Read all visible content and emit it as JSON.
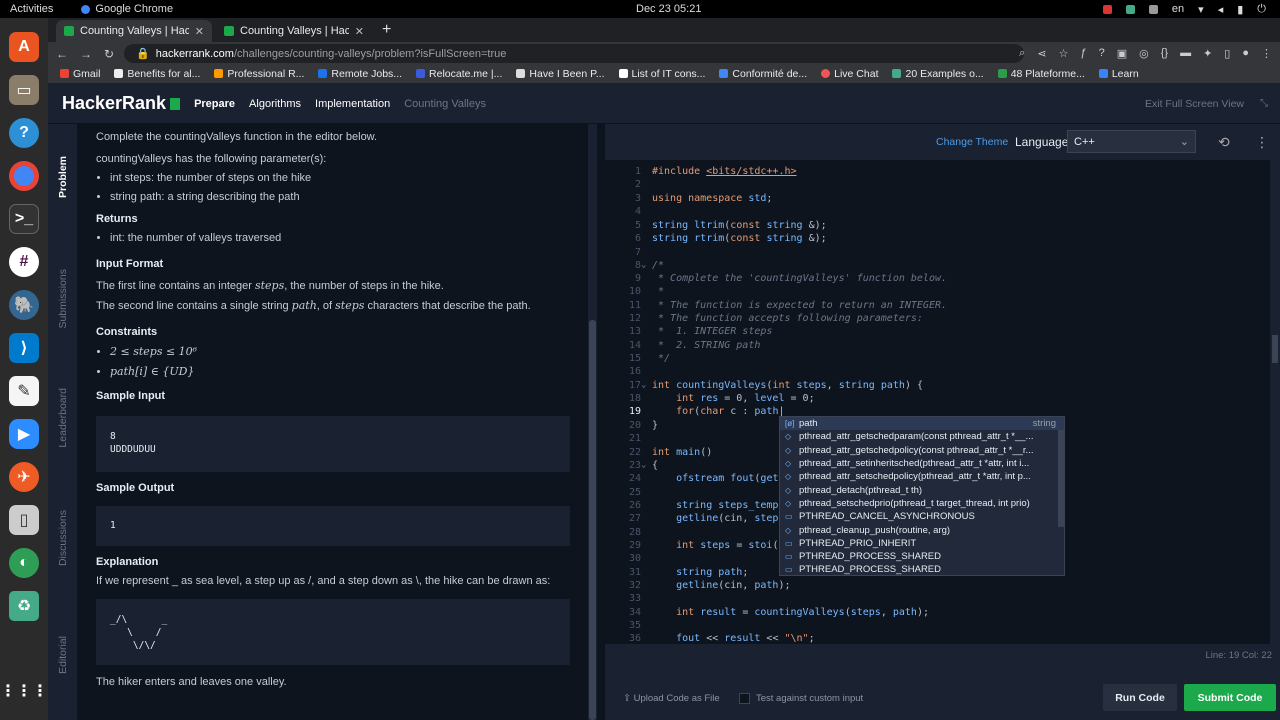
{
  "os": {
    "activities": "Activities",
    "app_name": "Google Chrome",
    "clock": "Dec 23  05:21",
    "lang": "en"
  },
  "browser": {
    "tabs": [
      {
        "title": "Counting Valleys | Hacker"
      },
      {
        "title": "Counting Valleys | Hacker"
      }
    ],
    "url_host": "hackerrank.com",
    "url_path": "/challenges/counting-valleys/problem?isFullScreen=true",
    "bookmarks": [
      "Gmail",
      "Benefits for al...",
      "Professional R...",
      "Remote Jobs...",
      "Relocate.me |...",
      "Have I Been P...",
      "List of IT cons...",
      "Conformité de...",
      "Live Chat",
      "20 Examples o...",
      "48 Plateforme...",
      "Learn"
    ]
  },
  "nav": {
    "logo": "HackerRank",
    "crumbs": [
      "Prepare",
      "Algorithms",
      "Implementation",
      "Counting Valleys"
    ],
    "exit_fullscreen": "Exit Full Screen View"
  },
  "side_tabs": [
    "Problem",
    "Submissions",
    "Leaderboard",
    "Discussions",
    "Editorial"
  ],
  "problem": {
    "intro": "Complete the countingValleys function in the editor below.",
    "params_intro": "countingValleys has the following parameter(s):",
    "params": [
      "int steps: the number of steps on the hike",
      "string path: a string describing the path"
    ],
    "returns_h": "Returns",
    "returns": "int: the number of valleys traversed",
    "input_h": "Input Format",
    "input_1a": "The first line contains an integer ",
    "input_1v": "steps",
    "input_1b": ", the number of steps in the hike.",
    "input_2a": "The second line contains a single string ",
    "input_2v": "path",
    "input_2b": ", of ",
    "input_2v2": "steps",
    "input_2c": " characters that describe the path.",
    "constraints_h": "Constraints",
    "constraint_1": "2 ≤ steps ≤ 10⁶",
    "constraint_2": "path[i] ∈ {UD}",
    "sample_input_h": "Sample Input",
    "sample_input": "8\nUDDDUDUU",
    "sample_output_h": "Sample Output",
    "sample_output": "1",
    "explanation_h": "Explanation",
    "explanation": "If we represent _ as sea level, a step up as /, and a step down as \\, the hike can be drawn as:",
    "drawing": "_/\\      _\n   \\    /\n    \\/\\/",
    "conclusion": "The hiker enters and leaves one valley."
  },
  "editor": {
    "change_theme": "Change Theme",
    "language_label": "Language",
    "language": "C++",
    "status": "Line: 19  Col: 22",
    "upload": "Upload Code as File",
    "custom_input": "Test against custom input",
    "run": "Run Code",
    "submit": "Submit Code",
    "line_numbers": [
      "1",
      "2",
      "3",
      "4",
      "5",
      "6",
      "7",
      "8",
      "9",
      "10",
      "11",
      "12",
      "13",
      "14",
      "15",
      "16",
      "17",
      "18",
      "19",
      "20",
      "21",
      "22",
      "23",
      "24",
      "25",
      "26",
      "27",
      "28",
      "29",
      "30",
      "31",
      "32",
      "33",
      "34",
      "35",
      "36"
    ],
    "autocomplete": [
      {
        "label": "path",
        "type": "string"
      },
      {
        "label": "pthread_attr_getschedparam(const pthread_attr_t *__...",
        "type": ""
      },
      {
        "label": "pthread_attr_getschedpolicy(const pthread_attr_t *__r...",
        "type": ""
      },
      {
        "label": "pthread_attr_setinheritsched(pthread_attr_t *attr, int i...",
        "type": ""
      },
      {
        "label": "pthread_attr_setschedpolicy(pthread_attr_t *attr, int p...",
        "type": ""
      },
      {
        "label": "pthread_detach(pthread_t th)",
        "type": ""
      },
      {
        "label": "pthread_setschedprio(pthread_t target_thread, int prio)",
        "type": ""
      },
      {
        "label": "PTHREAD_CANCEL_ASYNCHRONOUS",
        "type": ""
      },
      {
        "label": "pthread_cleanup_push(routine, arg)",
        "type": ""
      },
      {
        "label": "PTHREAD_PRIO_INHERIT",
        "type": ""
      },
      {
        "label": "PTHREAD_PROCESS_SHARED",
        "type": ""
      },
      {
        "label": "PTHREAD_PROCESS_SHARED",
        "type": ""
      }
    ]
  },
  "colors": {
    "brand_green": "#1ba94c",
    "link_blue": "#4b9ce8",
    "bg_dark": "#0e141e",
    "panel": "#1a2130"
  }
}
